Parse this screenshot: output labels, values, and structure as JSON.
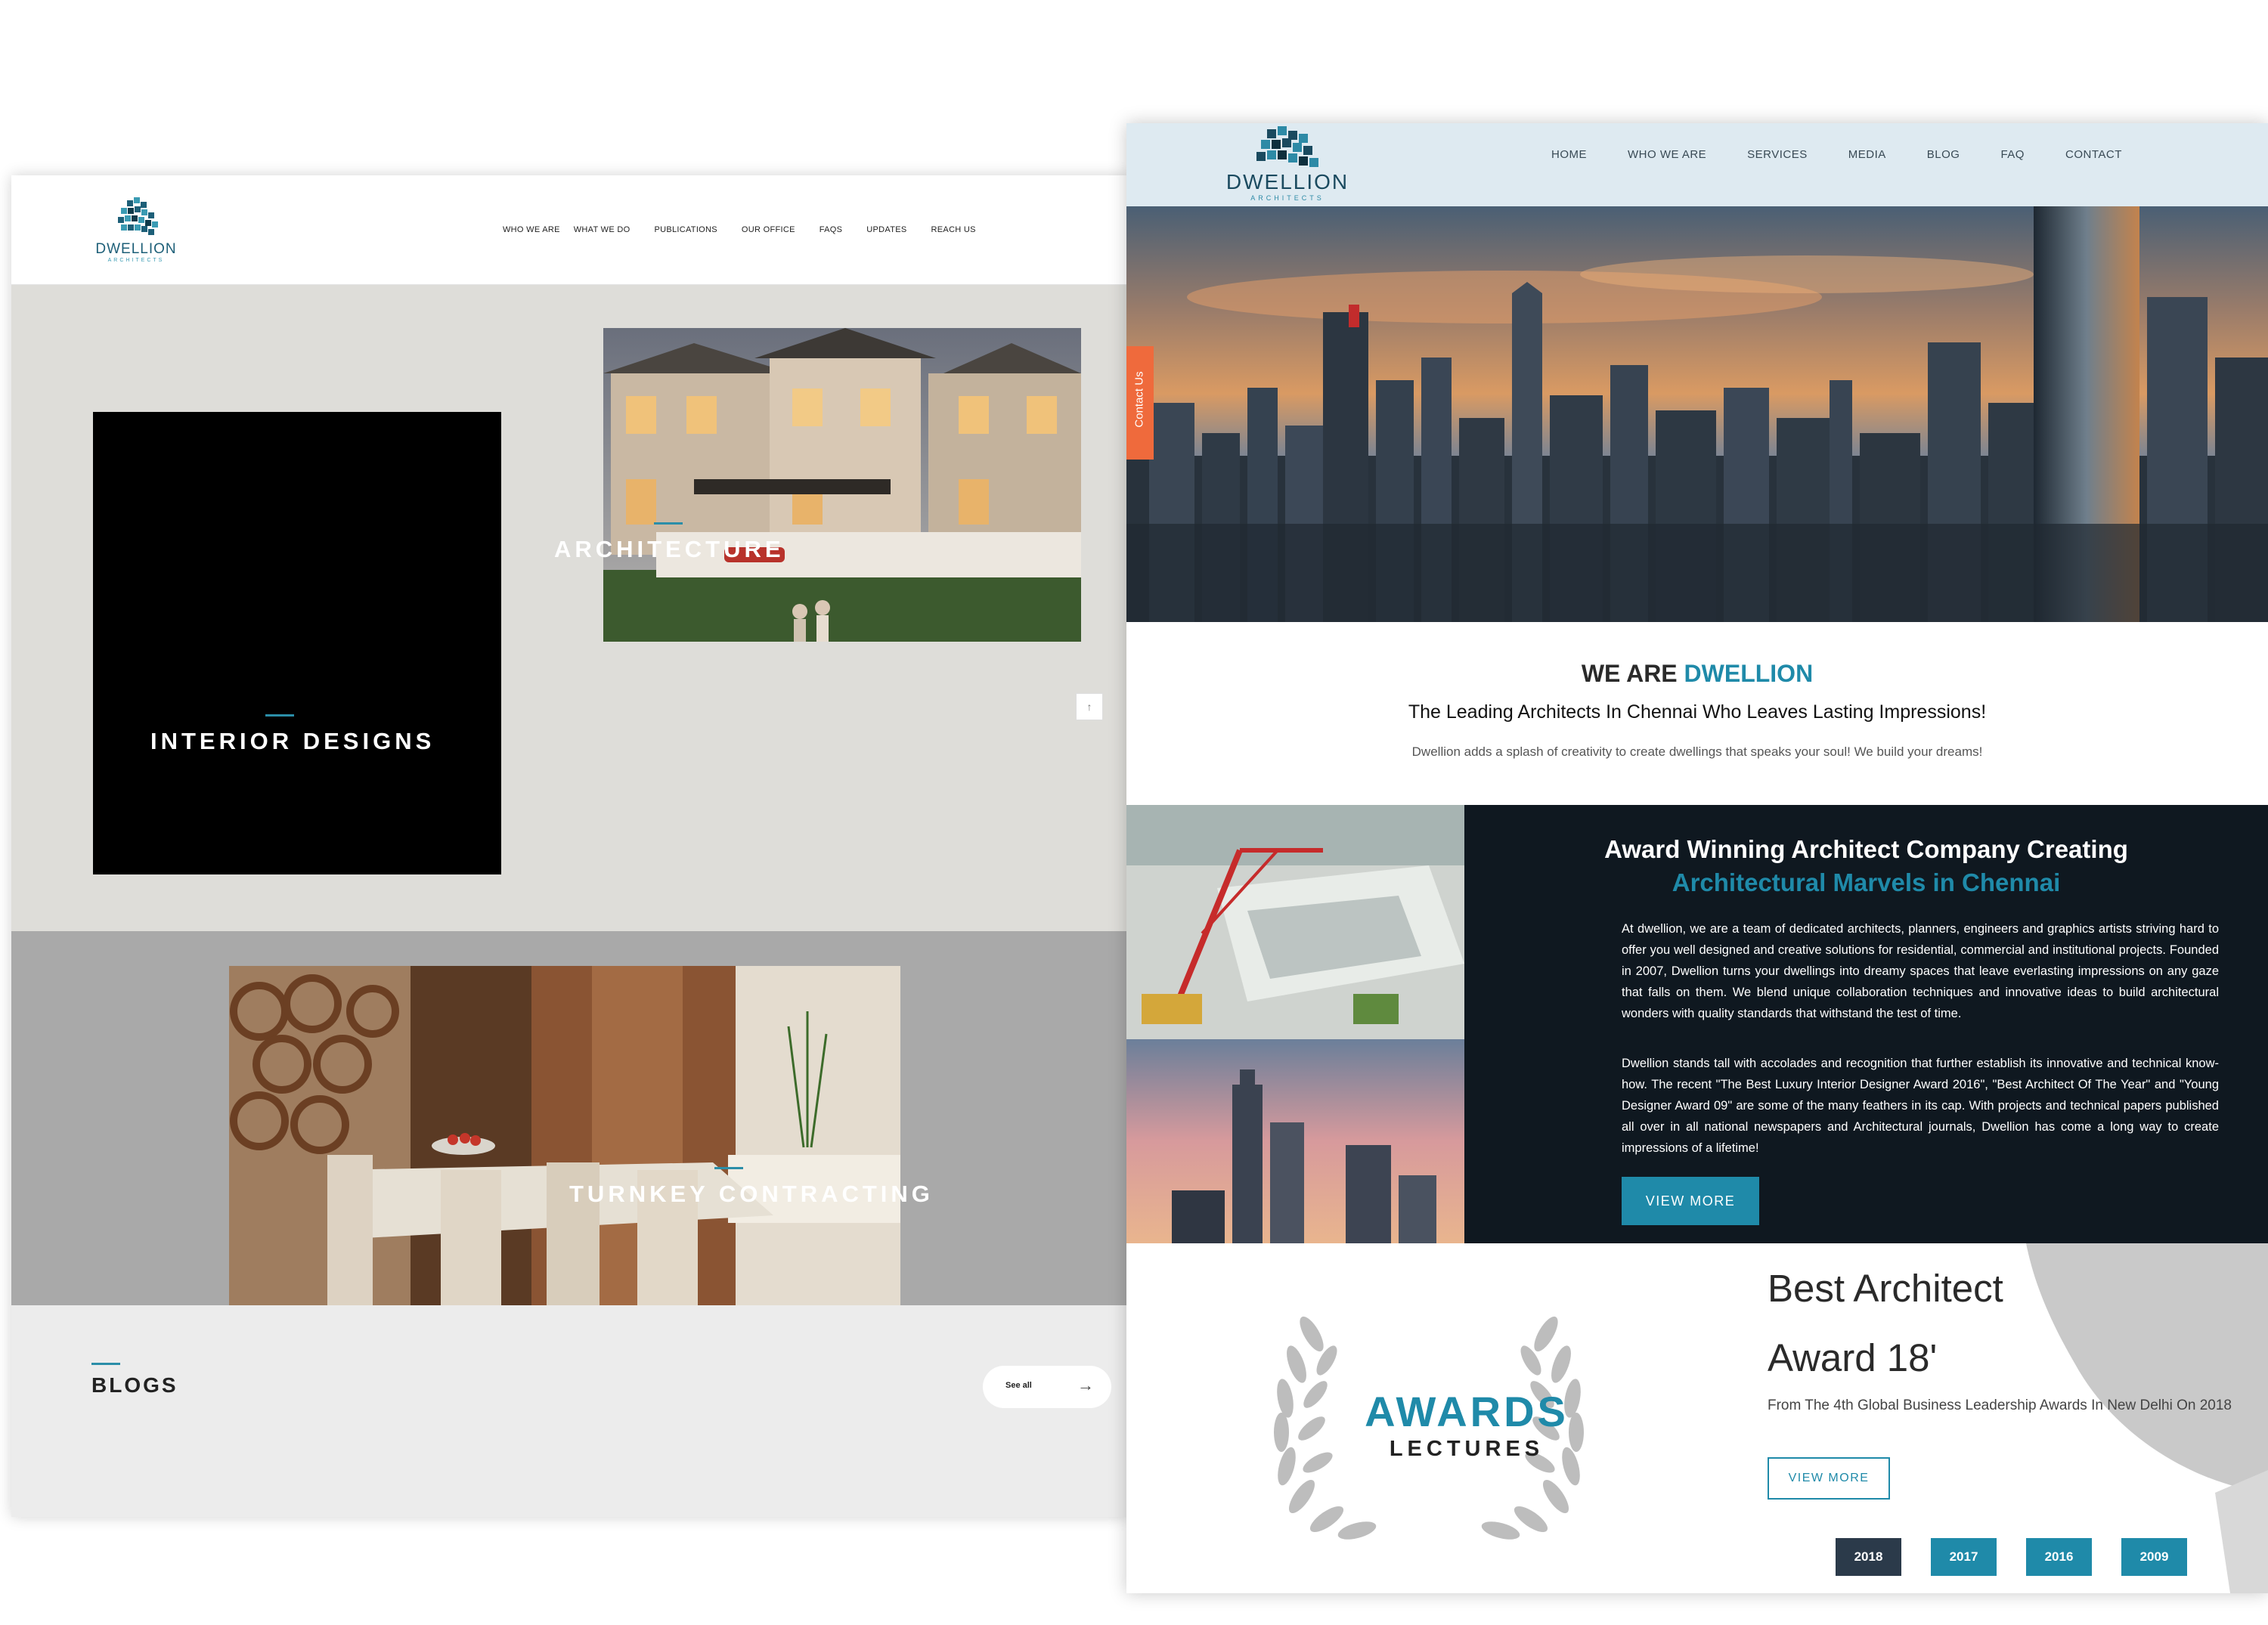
{
  "left_page": {
    "logo": {
      "name": "DWELLION",
      "sub": "ARCHITECTS"
    },
    "nav": [
      "WHO WE ARE",
      "WHAT WE DO",
      "PUBLICATIONS",
      "OUR OFFICE",
      "FAQS",
      "UPDATES",
      "REACH US"
    ],
    "sections": {
      "interior": "INTERIOR DESIGNS",
      "architecture": "ARCHITECTURE",
      "turnkey": "TURNKEY CONTRACTING"
    },
    "scroll_up_icon": "↑",
    "blogs": {
      "title": "BLOGS",
      "see_all": "See all",
      "arrow": "→"
    }
  },
  "right_page": {
    "logo": {
      "name": "DWELLION",
      "sub": "ARCHITECTS"
    },
    "nav": [
      "HOME",
      "WHO WE ARE",
      "SERVICES",
      "MEDIA",
      "BLOG",
      "FAQ",
      "CONTACT"
    ],
    "contact_tab": "Contact Us",
    "intro": {
      "heading_prefix": "WE ARE ",
      "heading_accent": "DWELLION",
      "tagline": "The Leading Architects In Chennai Who Leaves Lasting Impressions!",
      "text": "Dwellion adds a splash of creativity to create dwellings that speaks your soul! We build your dreams!"
    },
    "about": {
      "title_line1": "Award Winning Architect Company Creating",
      "title_line2": "Architectural Marvels in Chennai",
      "para1": "At dwellion, we are a team of dedicated architects, planners, engineers and graphics artists striving hard to offer you well designed and creative solutions for residential, commercial and institutional projects. Founded in 2007, Dwellion turns your dwellings into dreamy spaces that leave everlasting impressions on any gaze that falls on them. We blend unique collaboration techniques and innovative ideas to build architectural wonders with quality standards that withstand the test of time.",
      "para2": "Dwellion stands tall with accolades and recognition that further establish its innovative and technical know-how. The recent \"The Best Luxury Interior Designer Award 2016\", \"Best Architect Of The Year\" and \"Young Designer Award 09\" are some of the many feathers in its cap. With projects and technical papers published all over in all national newspapers and Architectural journals, Dwellion has come a long way to create impressions of a lifetime!",
      "button": "VIEW MORE"
    },
    "awards": {
      "badge_title": "AWARDS",
      "badge_sub": "LECTURES",
      "title_line1": "Best Architect",
      "title_line2": "Award 18'",
      "description": "From The 4th Global Business Leadership Awards In New Delhi On 2018",
      "button": "VIEW MORE",
      "years": [
        "2018",
        "2017",
        "2016",
        "2009"
      ],
      "active_year": "2018"
    }
  },
  "colors": {
    "accent": "#1f8aa9",
    "contact_tab": "#ef6a3c",
    "year_active": "#2b3a4a",
    "year_inactive": "#1f8aa9"
  }
}
